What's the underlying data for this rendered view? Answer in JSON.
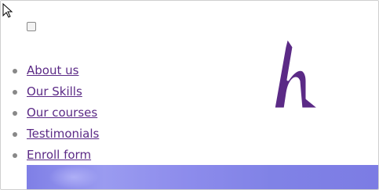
{
  "header": {
    "menu_toggle": {
      "checked": false
    },
    "logo": {
      "icon": "h-logo-icon",
      "colors": {
        "fill": "#5b2a86",
        "outline": "#ffffff"
      }
    }
  },
  "nav": {
    "items": [
      {
        "label": "About us"
      },
      {
        "label": "Our Skills"
      },
      {
        "label": "Our courses"
      },
      {
        "label": "Testimonials"
      },
      {
        "label": "Enroll form"
      }
    ]
  },
  "colors": {
    "link": "#5b2a86",
    "banner": "#8585ea"
  }
}
